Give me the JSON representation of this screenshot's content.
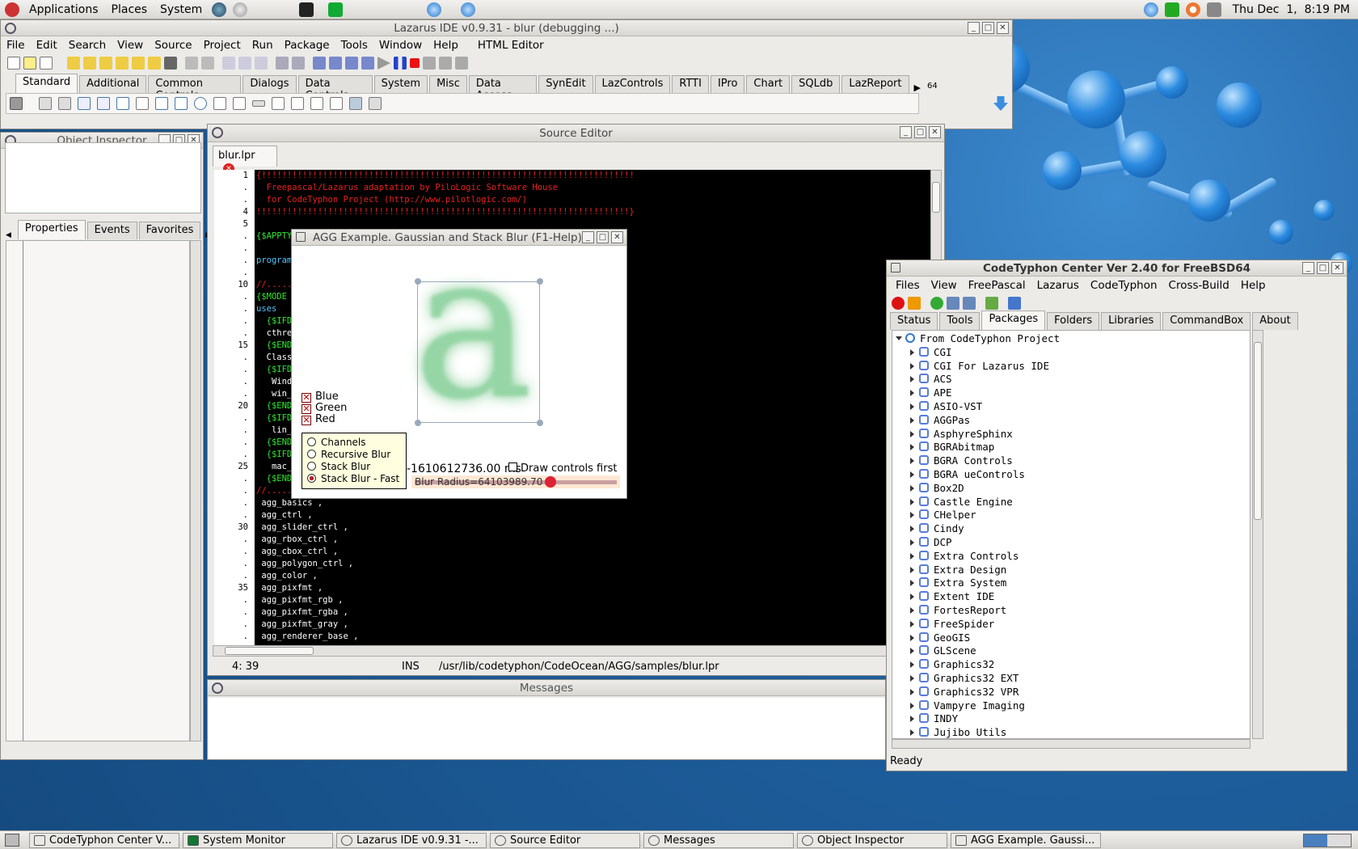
{
  "top_panel": {
    "menus": [
      "Applications",
      "Places",
      "System"
    ],
    "clock": "Thu Dec  1,  8:19 PM"
  },
  "ide": {
    "title": "Lazarus IDE v0.9.31 - blur (debugging ...)",
    "menu": [
      "File",
      "Edit",
      "Search",
      "View",
      "Source",
      "Project",
      "Run",
      "Package",
      "Tools",
      "Window",
      "Help",
      "HTML Editor"
    ],
    "palette_tabs": [
      "Standard",
      "Additional",
      "Common Controls",
      "Dialogs",
      "Data Controls",
      "System",
      "Misc",
      "Data Access",
      "SynEdit",
      "LazControls",
      "RTTI",
      "IPro",
      "Chart",
      "SQLdb",
      "LazReport"
    ],
    "palette_badge": "64"
  },
  "object_inspector": {
    "title": "Object Inspector",
    "tabs": [
      "Properties",
      "Events",
      "Favorites"
    ]
  },
  "source_editor": {
    "title": "Source Editor",
    "file_tab": "blur.lpr",
    "line_numbers": [
      "1",
      ".",
      ".",
      "4",
      "5",
      ".",
      ".",
      ".",
      ".",
      "10",
      ".",
      ".",
      ".",
      ".",
      "15",
      ".",
      ".",
      ".",
      ".",
      "20",
      ".",
      ".",
      ".",
      ".",
      "25",
      ".",
      ".",
      ".",
      ".",
      "30",
      ".",
      ".",
      ".",
      ".",
      "35",
      ".",
      ".",
      ".",
      "."
    ],
    "lines": [
      {
        "t": "{!!!!!!!!!!!!!!!!!!!!!!!!!!!!!!!!!!!!!!!!!!!!!!!!!!!!!!!!!!!!!!!!!!!!!!!!!",
        "c": "#e82020"
      },
      {
        "t": "  Freepascal/Lazarus adaptation by PiloLogic Software House",
        "c": "#e82020"
      },
      {
        "t": "  for CodeTyphon Project (http://www.pilotlogic.com/)",
        "c": "#e82020"
      },
      {
        "t": "!!!!!!!!!!!!!!!!!!!!!!!!!!!!!!!!!!!!!!!!!!!!!!!!!!!!!!!!!!!!!!!!!!!!!!!!!}",
        "c": "#e82020"
      },
      {
        "t": "",
        "c": "#fff"
      },
      {
        "t": "{$APPTY",
        "c": "#2ee82e"
      },
      {
        "t": "",
        "c": "#fff"
      },
      {
        "t": "program",
        "c": "#4fc8ff"
      },
      {
        "t": "",
        "c": "#fff"
      },
      {
        "t": "//.....",
        "c": "#e82020"
      },
      {
        "t": "{$MODE",
        "c": "#2ee82e"
      },
      {
        "t": "uses",
        "c": "#4fc8ff"
      },
      {
        "t": "  {$IFD",
        "c": "#2ee82e"
      },
      {
        "t": "  cthre",
        "c": "#ffffff"
      },
      {
        "t": "  {$END",
        "c": "#2ee82e"
      },
      {
        "t": "  Class",
        "c": "#ffffff"
      },
      {
        "t": "  {$IFD",
        "c": "#2ee82e"
      },
      {
        "t": "   Wind",
        "c": "#ffffff"
      },
      {
        "t": "   win_",
        "c": "#ffffff"
      },
      {
        "t": "  {$END",
        "c": "#2ee82e"
      },
      {
        "t": "  {$IFD",
        "c": "#2ee82e"
      },
      {
        "t": "   lin_",
        "c": "#ffffff"
      },
      {
        "t": "  {$END",
        "c": "#2ee82e"
      },
      {
        "t": "  {$IFD",
        "c": "#2ee82e"
      },
      {
        "t": "   mac_",
        "c": "#ffffff"
      },
      {
        "t": "  {$END",
        "c": "#2ee82e"
      },
      {
        "t": "//.....",
        "c": "#e82020"
      },
      {
        "t": " agg_basics ,",
        "c": "#ffffff"
      },
      {
        "t": " agg_ctrl ,",
        "c": "#ffffff"
      },
      {
        "t": " agg_slider_ctrl ,",
        "c": "#ffffff"
      },
      {
        "t": " agg_rbox_ctrl ,",
        "c": "#ffffff"
      },
      {
        "t": " agg_cbox_ctrl ,",
        "c": "#ffffff"
      },
      {
        "t": " agg_polygon_ctrl ,",
        "c": "#ffffff"
      },
      {
        "t": " agg_color ,",
        "c": "#ffffff"
      },
      {
        "t": " agg_pixfmt ,",
        "c": "#ffffff"
      },
      {
        "t": " agg_pixfmt_rgb ,",
        "c": "#ffffff"
      },
      {
        "t": " agg_pixfmt_rgba ,",
        "c": "#ffffff"
      },
      {
        "t": " agg_pixfmt_gray ,",
        "c": "#ffffff"
      },
      {
        "t": " agg_renderer_base ,",
        "c": "#ffffff"
      }
    ],
    "status_pos": "4: 39",
    "status_mode": "INS",
    "status_path": "/usr/lib/codetyphon/CodeOcean/AGG/samples/blur.lpr"
  },
  "messages": {
    "title": "Messages"
  },
  "agg": {
    "title": "AGG Example. Gaussian and Stack Blur (F1-Help)",
    "letter": "a",
    "checkboxes": [
      "Blue",
      "Green",
      "Red"
    ],
    "radios": [
      "Channels",
      "Recursive Blur",
      "Stack Blur",
      "Stack Blur - Fast"
    ],
    "selected_radio": 3,
    "time_value": "-1610612736.00 ms",
    "draw_first_label": "Draw controls first",
    "slider_label": "Blur Radius=64103989.70",
    "slider_fraction": 0.67
  },
  "center": {
    "title": "CodeTyphon Center Ver 2.40 for FreeBSD64",
    "menu": [
      "Files",
      "View",
      "FreePascal",
      "Lazarus",
      "CodeTyphon",
      "Cross-Build",
      "Help"
    ],
    "tabs": [
      "Status",
      "Tools",
      "Packages",
      "Folders",
      "Libraries",
      "CommandBox",
      "About"
    ],
    "active_tab": "Packages",
    "tree_root": "From CodeTyphon Project",
    "packages": [
      "CGI",
      "CGI For Lazarus IDE",
      "ACS",
      "APE",
      "ASIO-VST",
      "AGGPas",
      "AsphyreSphinx",
      "BGRAbitmap",
      "BGRA Controls",
      "BGRA ueControls",
      "Box2D",
      "Castle Engine",
      "CHelper",
      "Cindy",
      "DCP",
      "Extra Controls",
      "Extra Design",
      "Extra System",
      "Extent IDE",
      "FortesReport",
      "FreeSpider",
      "GeoGIS",
      "GLScene",
      "Graphics32",
      "Graphics32 EXT",
      "Graphics32 VPR",
      "Vampyre Imaging",
      "INDY",
      "Jujibo Utils"
    ],
    "status": "Ready"
  },
  "taskbar": [
    "CodeTyphon Center V...",
    "System Monitor",
    "Lazarus IDE v0.9.31 -...",
    "Source Editor",
    "Messages",
    "Object Inspector",
    "AGG Example. Gaussi..."
  ],
  "colors": {
    "accent_red": "#cc2222",
    "desktop_blue": "#1e5f9e",
    "code_bg": "#000000"
  }
}
